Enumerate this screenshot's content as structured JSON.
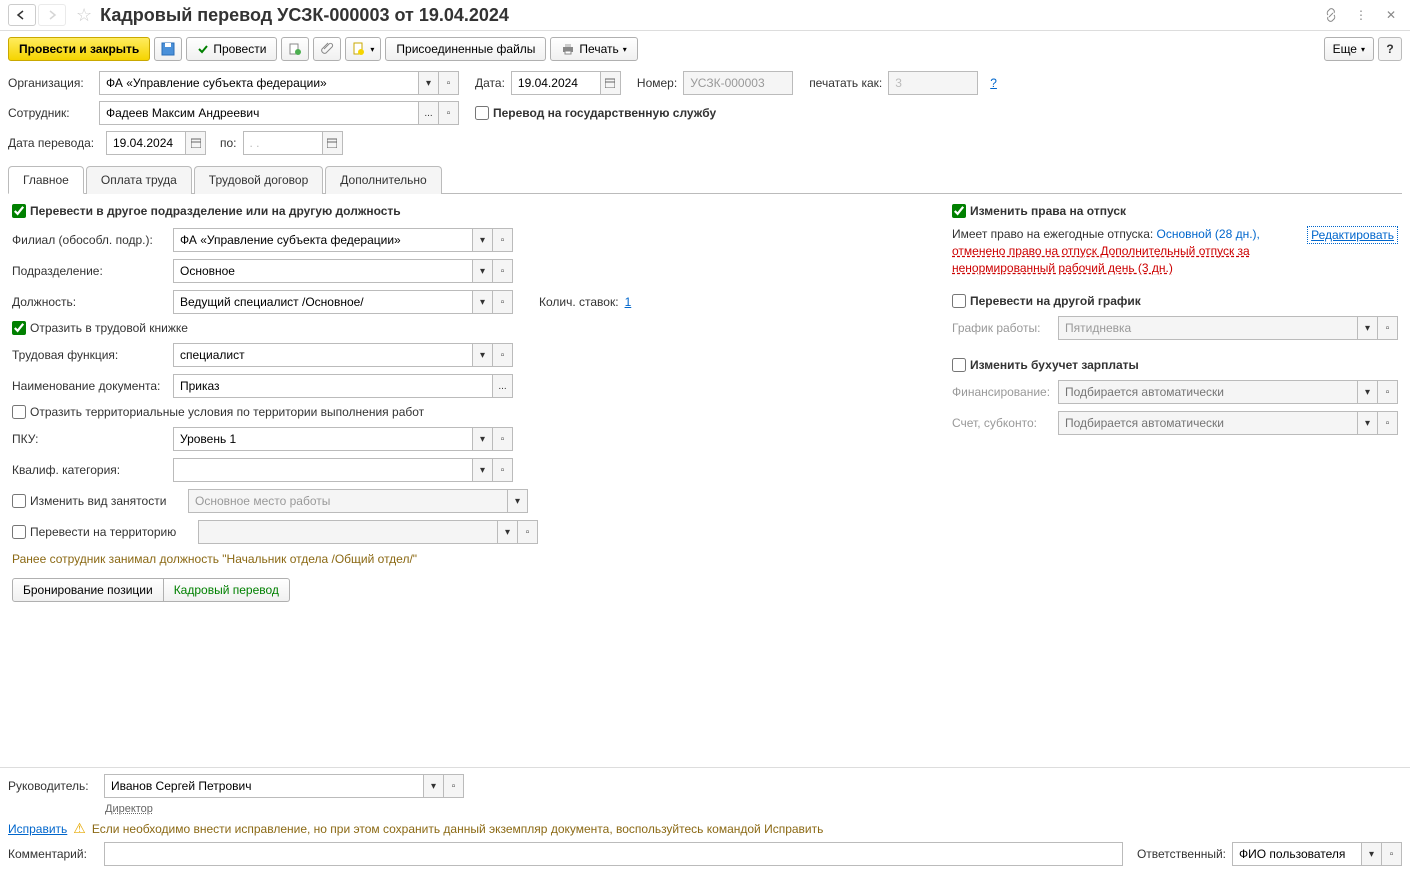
{
  "title": "Кадровый перевод УСЗК-000003 от 19.04.2024",
  "toolbar": {
    "post_close": "Провести и закрыть",
    "post": "Провести",
    "attached": "Присоединенные файлы",
    "print": "Печать",
    "more": "Еще"
  },
  "header": {
    "org_label": "Организация:",
    "org_value": "ФА «Управление субъекта федерации»",
    "date_label": "Дата:",
    "date_value": "19.04.2024",
    "number_label": "Номер:",
    "number_value": "УСЗК-000003",
    "print_as_label": "печатать как:",
    "print_as_value": "3",
    "employee_label": "Сотрудник:",
    "employee_value": "Фадеев Максим Андреевич",
    "gov_service": "Перевод на государственную службу",
    "transfer_date_label": "Дата перевода:",
    "transfer_date_value": "19.04.2024",
    "to_label": "по:",
    "to_value": ". ."
  },
  "tabs": [
    "Главное",
    "Оплата труда",
    "Трудовой договор",
    "Дополнительно"
  ],
  "main_tab": {
    "transfer_dept_check": "Перевести в другое подразделение или на другую должность",
    "branch_label": "Филиал (обособл. подр.):",
    "branch_value": "ФА «Управление субъекта федерации»",
    "dept_label": "Подразделение:",
    "dept_value": "Основное",
    "position_label": "Должность:",
    "position_value": "Ведущий специалист /Основное/",
    "rates_label": "Колич. ставок:",
    "rates_value": "1",
    "workbook_check": "Отразить в трудовой книжке",
    "function_label": "Трудовая функция:",
    "function_value": "специалист",
    "docname_label": "Наименование документа:",
    "docname_value": "Приказ",
    "territory_check": "Отразить территориальные условия по территории выполнения работ",
    "pku_label": "ПКУ:",
    "pku_value": "Уровень 1",
    "qualif_label": "Квалиф. категория:",
    "qualif_value": "",
    "employment_check": "Изменить вид занятости",
    "employment_value": "Основное место работы",
    "territory2_check": "Перевести на территорию",
    "previous_note": "Ранее сотрудник занимал должность \"Начальник отдела /Общий отдел/\"",
    "btn_booking": "Бронирование позиции",
    "btn_transfer": "Кадровый перевод"
  },
  "right": {
    "vacation_check": "Изменить права на отпуск",
    "vacation_prefix": "Имеет право на ежегодные отпуска: ",
    "vacation_main": "Основной (28 дн.),",
    "vacation_cancel": "отменено право на отпуск Дополнительный отпуск за ненормированный рабочий день (3 дн.)",
    "edit_link": "Редактировать",
    "schedule_check": "Перевести на другой график",
    "schedule_label": "График работы:",
    "schedule_value": "Пятидневка",
    "accounting_check": "Изменить бухучет зарплаты",
    "financing_label": "Финансирование:",
    "financing_placeholder": "Подбирается автоматически",
    "account_label": "Счет, субконто:",
    "account_placeholder": "Подбирается автоматически"
  },
  "footer": {
    "manager_label": "Руководитель:",
    "manager_value": "Иванов Сергей Петрович",
    "director": "Директор",
    "fix_link": "Исправить",
    "fix_note": "Если необходимо внести исправление, но при этом сохранить данный экземпляр документа, воспользуйтесь командой Исправить",
    "comment_label": "Комментарий:",
    "responsible_label": "Ответственный:",
    "responsible_value": "ФИО пользователя"
  }
}
